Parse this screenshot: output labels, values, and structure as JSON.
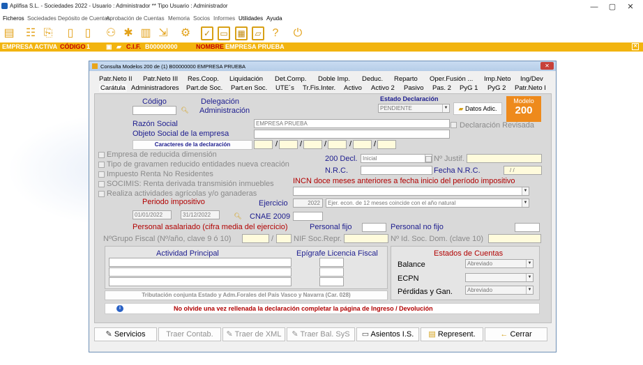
{
  "window": {
    "title": "Aplifisa S.L.   - Sociedades 2022 -  Usuario : Administrador  **  Tipo Usuario : Administrador",
    "minimize": "—",
    "maximize": "▢",
    "close": "✕"
  },
  "menu": [
    "Ficheros",
    "Sociedades",
    "Depósito de Cuentas",
    "Aprobación de Cuentas",
    "Memoria",
    "Socios",
    "Informes",
    "Utilidades",
    "Ayuda"
  ],
  "company_bar": {
    "empresa_activa": "EMPRESA ACTIVA",
    "codigo_label": "CÓDIGO",
    "codigo": "1",
    "cif_label": "C.I.F.",
    "cif": "B00000000",
    "nombre_label": "NOMBRE",
    "nombre": "EMPRESA PRUEBA",
    "close": "✕"
  },
  "dialog": {
    "title": "Consulta Modelos 200 de (1) B00000000 EMPRESA PRUEBA",
    "close": "✕",
    "tabs_row1": [
      "Patr.Neto II",
      "Patr.Neto III",
      "Res.Coop.",
      "Liquidación",
      "Det.Comp.",
      "Doble Imp.",
      "Deduc.",
      "Reparto",
      "Oper.Fusión ...",
      "Imp.Neto",
      "Ing/Dev"
    ],
    "tabs_row2": [
      "Carátula",
      "Administradores",
      "Part.de Soc.",
      "Part.en Soc.",
      "UTE´s",
      "Tr.Fis.Inter.",
      "Activo",
      "Activo 2",
      "Pasivo",
      "Pas. 2",
      "PyG 1",
      "PyG 2",
      "Patr.Neto I"
    ],
    "codigo_label": "Código",
    "delegacion_label": "Delegación",
    "administracion_label": "Administración",
    "estado_declaracion_label": "Estado Declaración",
    "estado_declaracion_value": "PENDIENTE",
    "datos_adic_button": "Datos Adic.",
    "modelo_label": "Modelo",
    "modelo_value": "200",
    "razon_social_label": "Razón Social",
    "razon_social_value": "EMPRESA PRUEBA",
    "objeto_social_label": "Objeto Social de la empresa",
    "declaracion_revisada_label": "Declaración Revisada",
    "caracteres_button": "Caracteres de la declaración",
    "checks": [
      "Empresa de reducida dimensión",
      "Tipo de gravamen reducido entidades nueva creación",
      "Impuesto Renta No Residentes",
      "SOCIMIS: Renta derivada transmisión inmuebles",
      "Realiza actividades agrícolas y/o ganaderas"
    ],
    "decl_200_label": "200 Decl.",
    "decl_200_value": "Inicial",
    "num_justif_label": "Nº Justif.",
    "nrc_label": "N.R.C.",
    "fecha_nrc_label": "Fecha N.R.C.",
    "fecha_nrc_value": "/  /",
    "incn_label": "INCN doce meses anteriores a fecha inicio del período impositivo",
    "periodo_label": "Periodo impositivo",
    "periodo_desde": "01/01/2022",
    "periodo_hasta": "31/12/2022",
    "ejercicio_label": "Ejercicio",
    "ejercicio_value": "2022",
    "ejercicio_desc": "Ejer. econ. de 12 meses coincide con el año natural",
    "cnae_label": "CNAE 2009",
    "personal_label": "Personal asalariado (cifra media del ejercicio)",
    "personal_fijo_label": "Personal fijo",
    "personal_no_fijo_label": "Personal no fijo",
    "grupo_fiscal_label": "NºGrupo Fiscal (Nº/año, clave 9 ó 10)",
    "nif_soc_label": "NIF Soc.Repr.",
    "num_id_label": "Nº Id. Soc. Dom. (clave 10)",
    "actividad_label": "Actividad Principal",
    "epigrafe_label": "Epígrafe Licencia Fiscal",
    "estados_label": "Estados de Cuentas",
    "balance_label": "Balance",
    "balance_value": "Abreviado",
    "ecpn_label": "ECPN",
    "ecpn_value": "",
    "perdidas_label": "Pérdidas y Gan.",
    "perdidas_value": "Abreviado",
    "tributacion_label": "Tributación conjunta Estado y Adm.Forales del País Vasco y Navarra (Car. 028)",
    "info_message": "No olvide una vez rellenada la declaración completar la página de Ingreso / Devolución",
    "buttons": {
      "servicios": "Servicios",
      "traer_contab": "Traer Contab.",
      "traer_xml": "Traer de XML",
      "traer_bal": "Traer Bal. SyS",
      "asientos": "Asientos I.S.",
      "represent": "Represent.",
      "cerrar": "Cerrar"
    }
  }
}
